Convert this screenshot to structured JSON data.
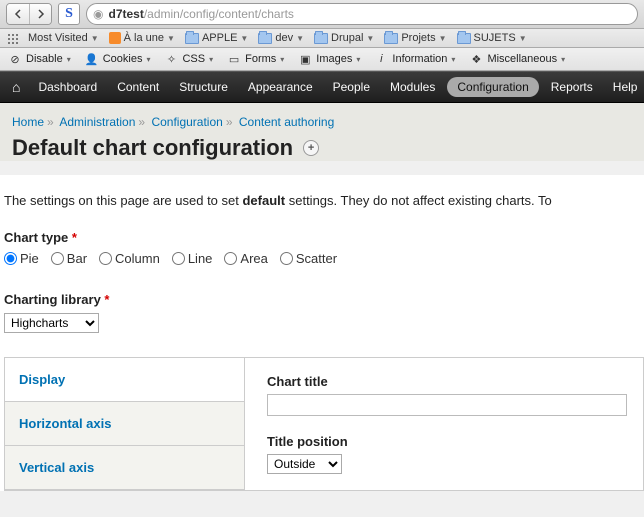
{
  "browser": {
    "s_label": "S",
    "url_host": "d7test",
    "url_path": "/admin/config/content/charts"
  },
  "bookmarks": {
    "most_visited": "Most Visited",
    "items": [
      "À la une",
      "APPLE",
      "dev",
      "Drupal",
      "Projets",
      "SUJETS"
    ]
  },
  "devtools": {
    "disable": "Disable",
    "cookies": "Cookies",
    "css": "CSS",
    "forms": "Forms",
    "images": "Images",
    "information": "Information",
    "misc": "Miscellaneous"
  },
  "adminnav": {
    "dashboard": "Dashboard",
    "content": "Content",
    "structure": "Structure",
    "appearance": "Appearance",
    "people": "People",
    "modules": "Modules",
    "configuration": "Configuration",
    "reports": "Reports",
    "help": "Help"
  },
  "breadcrumbs": {
    "home": "Home",
    "admin": "Administration",
    "config": "Configuration",
    "content_auth": "Content authoring"
  },
  "page": {
    "title": "Default chart configuration",
    "intro_a": "The settings on this page are used to set ",
    "intro_bold": "default",
    "intro_b": " settings. They do not affect existing charts. To"
  },
  "form": {
    "chart_type_label": "Chart type",
    "types": {
      "pie": "Pie",
      "bar": "Bar",
      "column": "Column",
      "line": "Line",
      "area": "Area",
      "scatter": "Scatter"
    },
    "library_label": "Charting library",
    "library_value": "Highcharts",
    "vtabs": {
      "display": "Display",
      "haxis": "Horizontal axis",
      "vaxis": "Vertical axis"
    },
    "chart_title_label": "Chart title",
    "chart_title_value": "",
    "title_position_label": "Title position",
    "title_position_value": "Outside"
  }
}
